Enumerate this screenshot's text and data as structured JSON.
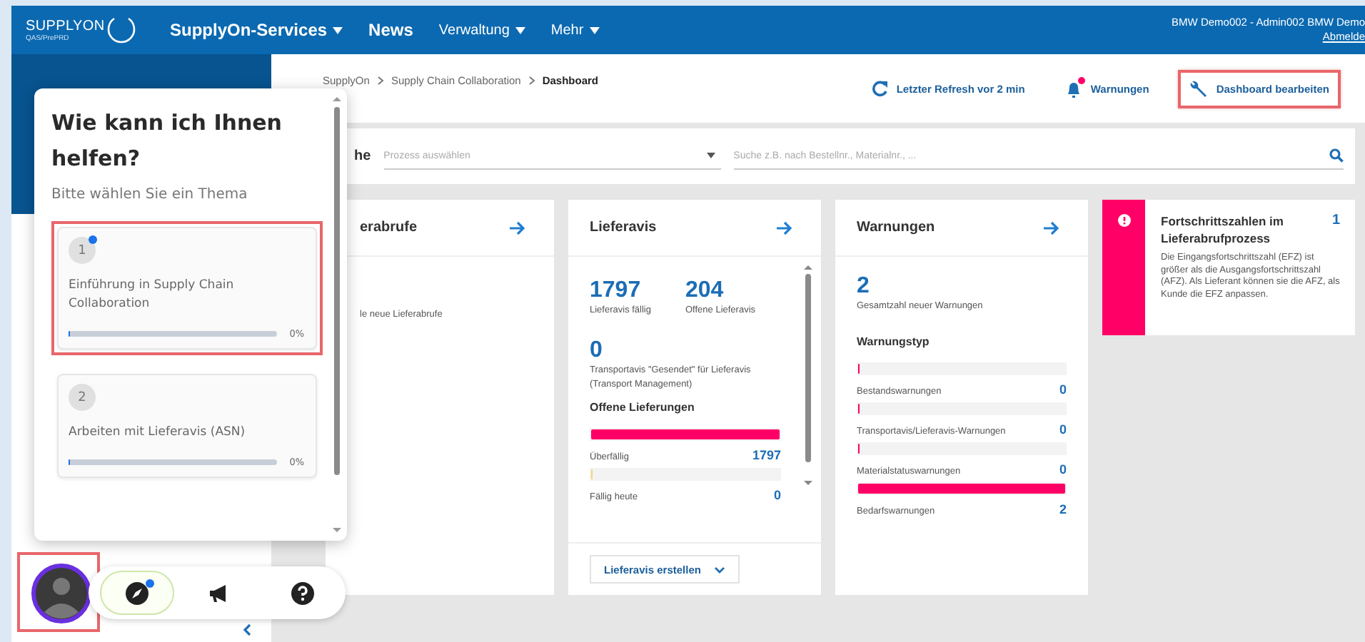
{
  "header": {
    "logo": {
      "name": "SUPPLYON",
      "env": "QAS/PrePRD"
    },
    "nav": [
      {
        "label": "SupplyOn-Services",
        "bold": true,
        "dropdown": true
      },
      {
        "label": "News",
        "bold": true,
        "dropdown": false
      },
      {
        "label": "Verwaltung",
        "bold": false,
        "dropdown": true
      },
      {
        "label": "Mehr",
        "bold": false,
        "dropdown": true
      }
    ],
    "user": {
      "name": "BMW Demo002 - Admin002 BMW Demo",
      "logout": "Abmelde"
    }
  },
  "breadcrumb": [
    {
      "label": "SupplyOn",
      "current": false
    },
    {
      "label": "Supply Chain Collaboration",
      "current": false
    },
    {
      "label": "Dashboard",
      "current": true
    }
  ],
  "actions": [
    {
      "kind": "refresh",
      "label": "Letzter Refresh vor 2 min",
      "badge": false,
      "highlighted": false
    },
    {
      "kind": "alerts",
      "label": "Warnungen",
      "badge": true,
      "highlighted": false
    },
    {
      "kind": "edit",
      "label": "Dashboard bearbeiten",
      "badge": false,
      "highlighted": true
    }
  ],
  "search": {
    "label": "he",
    "process_placeholder": "Prozess auswählen",
    "placeholder": "Suche z.B. nach Bestellnr., Materialnr., ..."
  },
  "cards": [
    {
      "kind": "calls",
      "title": "erabrufe",
      "text": "le neue Lieferabrufe"
    },
    {
      "kind": "asn",
      "title": "Lieferavis",
      "stats": [
        {
          "value": "1797",
          "label": "Lieferavis fällig"
        },
        {
          "value": "204",
          "label": "Offene Lieferavis"
        }
      ],
      "transport": {
        "value": "0",
        "label": "Transportavis \"Gesendet\" für Lieferavis (Transport Management)"
      },
      "section": "Offene Lieferungen",
      "rows": [
        {
          "label": "Überfällig",
          "count": "1797",
          "level": 1,
          "color": "#ff0066"
        },
        {
          "label": "Fällig heute",
          "count": "0",
          "level": 0,
          "color": "#f5d76e"
        }
      ],
      "button": "Lieferavis erstellen"
    },
    {
      "kind": "warnings",
      "title": "Warnungen",
      "total": {
        "value": "2",
        "label": "Gesamtzahl neuer Warnungen"
      },
      "section": "Warnungstyp",
      "rows": [
        {
          "label": "Bestandswarnungen",
          "count": "0",
          "level": 0,
          "color": "#ff0066"
        },
        {
          "label": "Transportavis/Lieferavis-Warnungen",
          "count": "0",
          "level": 0,
          "color": "#ff0066"
        },
        {
          "label": "Materialstatuswarnungen",
          "count": "0",
          "level": 0,
          "color": "#ff0066"
        },
        {
          "label": "Bedarfswarnungen",
          "count": "2",
          "level": 1,
          "color": "#ff0066"
        }
      ]
    },
    {
      "kind": "alert",
      "title": "Fortschrittszahlen im Lieferabrufprozess",
      "count": "1",
      "text": "Die Eingangsfortschrittszahl (EFZ) ist größer als die Ausgangsfortschrittszahl (AFZ). Als Lieferant können sie die AFZ, als Kunde die EFZ anpassen."
    }
  ],
  "helper": {
    "title": "Wie kann ich Ihnen helfen?",
    "subtitle": "Bitte wählen Sie ein Thema",
    "topics": [
      {
        "number": "1",
        "title": "Einführung in Supply Chain Collaboration",
        "level": 0,
        "progress": "0%",
        "new": true,
        "highlighted": true
      },
      {
        "number": "2",
        "title": "Arbeiten mit Lieferavis (ASN)",
        "level": 0,
        "progress": "0%",
        "new": false,
        "highlighted": false
      }
    ],
    "avatar": {
      "highlighted": true
    },
    "tools": [
      {
        "kind": "compass",
        "selected": true,
        "badge": true
      },
      {
        "kind": "megaphone",
        "selected": false,
        "badge": false
      },
      {
        "kind": "help",
        "selected": false,
        "badge": false
      }
    ]
  }
}
